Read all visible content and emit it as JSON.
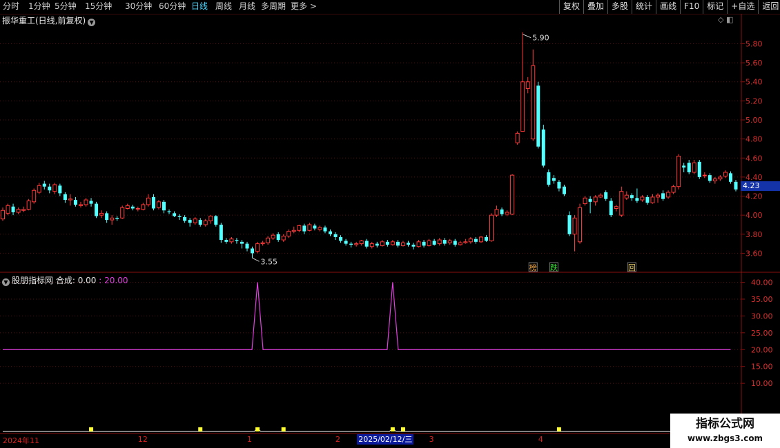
{
  "toolbar": {
    "periods": [
      "分时",
      "1分钟",
      "5分钟",
      "15分钟",
      "30分钟",
      "60分钟",
      "日线",
      "周线",
      "月线",
      "多周期",
      "更多 >"
    ],
    "active_index": 6,
    "right_buttons": [
      "复权",
      "叠加",
      "多股",
      "统计",
      "画线",
      "F10",
      "标记",
      "+自选",
      "返回"
    ]
  },
  "stock": {
    "title": "振华重工(日线,前复权)",
    "last_price": "4.23",
    "high_label": "5.90",
    "low_label": "3.55",
    "signals": [
      {
        "text": "榜",
        "color": "#e8a040",
        "index": 102
      },
      {
        "text": "跌",
        "color": "#33dd33",
        "index": 106
      },
      {
        "text": "回",
        "color": "#d8c060",
        "index": 121
      }
    ],
    "up_color": "#ff3b3b",
    "down_color": "#54ffff"
  },
  "price_axis": {
    "labels": [
      "5.80",
      "5.60",
      "5.40",
      "5.20",
      "5.00",
      "4.80",
      "4.60",
      "4.40",
      "4.20",
      "4.00",
      "3.80",
      "3.60"
    ],
    "max": 5.97,
    "min": 3.48
  },
  "indicator": {
    "name": "股朋指标网",
    "series_label": "合成:",
    "series_value": "0.00",
    "ref_value": "20.00",
    "color": "#e040e0",
    "axis_labels": [
      "40.00",
      "35.00",
      "30.00",
      "25.00",
      "20.00",
      "15.00",
      "10.00"
    ],
    "baseline": 20,
    "spikes": [
      {
        "index": 49,
        "value": 40
      },
      {
        "index": 75,
        "value": 40
      }
    ]
  },
  "markers": {
    "color": "#ffff33",
    "indices": [
      17,
      38,
      49,
      54,
      75,
      77,
      107
    ]
  },
  "date_axis": {
    "labels": [
      {
        "text": "2024年11",
        "index": 0
      },
      {
        "text": "12",
        "index": 26
      },
      {
        "text": "1",
        "index": 47
      },
      {
        "text": "2",
        "index": 64
      },
      {
        "text": "3",
        "index": 82
      },
      {
        "text": "4",
        "index": 103
      }
    ],
    "cursor_label": "2025/02/12/三",
    "cursor_index": 70
  },
  "watermark": {
    "line1": "指标公式网",
    "line2": "www.zbgs3.com"
  },
  "chart_data": {
    "type": "candlestick",
    "title": "振华重工(日线,前复权)",
    "ylim": [
      3.48,
      5.97
    ],
    "candles": [
      [
        3.96,
        4.05,
        4.08,
        3.94
      ],
      [
        4.02,
        4.1,
        4.12,
        4.0
      ],
      [
        4.09,
        4.03,
        4.12,
        4.0
      ],
      [
        4.03,
        4.06,
        4.08,
        4.01
      ],
      [
        4.05,
        4.06,
        4.09,
        4.03
      ],
      [
        4.06,
        4.15,
        4.17,
        4.05
      ],
      [
        4.14,
        4.26,
        4.28,
        4.12
      ],
      [
        4.24,
        4.31,
        4.34,
        4.22
      ],
      [
        4.33,
        4.3,
        4.36,
        4.27
      ],
      [
        4.3,
        4.26,
        4.33,
        4.23
      ],
      [
        4.25,
        4.32,
        4.34,
        4.22
      ],
      [
        4.31,
        4.23,
        4.33,
        4.2
      ],
      [
        4.22,
        4.16,
        4.24,
        4.13
      ],
      [
        4.16,
        4.17,
        4.22,
        4.1
      ],
      [
        4.16,
        4.11,
        4.19,
        4.09
      ],
      [
        4.1,
        4.11,
        4.14,
        4.08
      ],
      [
        4.11,
        4.16,
        4.18,
        4.09
      ],
      [
        4.15,
        4.12,
        4.18,
        4.09
      ],
      [
        4.12,
        3.99,
        4.14,
        3.97
      ],
      [
        4.0,
        4.02,
        4.05,
        3.97
      ],
      [
        4.02,
        3.95,
        4.04,
        3.92
      ],
      [
        3.95,
        3.97,
        4.0,
        3.9
      ],
      [
        3.97,
        3.96,
        3.99,
        3.94
      ],
      [
        3.97,
        4.08,
        4.1,
        3.96
      ],
      [
        4.07,
        4.1,
        4.12,
        4.06
      ],
      [
        4.09,
        4.07,
        4.11,
        4.05
      ],
      [
        4.07,
        4.07,
        4.09,
        4.04
      ],
      [
        4.06,
        4.11,
        4.13,
        4.05
      ],
      [
        4.11,
        4.18,
        4.22,
        4.09
      ],
      [
        4.19,
        4.07,
        4.22,
        4.05
      ],
      [
        4.08,
        4.14,
        4.16,
        4.06
      ],
      [
        4.14,
        4.05,
        4.16,
        4.02
      ],
      [
        4.04,
        4.03,
        4.06,
        4.01
      ],
      [
        4.02,
        3.99,
        4.04,
        3.98
      ],
      [
        3.99,
        3.98,
        4.01,
        3.95
      ],
      [
        3.98,
        3.94,
        4.0,
        3.92
      ],
      [
        3.95,
        3.92,
        3.97,
        3.88
      ],
      [
        3.92,
        3.96,
        3.98,
        3.9
      ],
      [
        3.95,
        3.9,
        3.97,
        3.88
      ],
      [
        3.9,
        3.94,
        3.96,
        3.88
      ],
      [
        3.94,
        3.99,
        4.0,
        3.91
      ],
      [
        3.99,
        3.9,
        4.0,
        3.88
      ],
      [
        3.9,
        3.74,
        3.92,
        3.71
      ],
      [
        3.74,
        3.72,
        3.76,
        3.7
      ],
      [
        3.72,
        3.75,
        3.77,
        3.7
      ],
      [
        3.74,
        3.73,
        3.76,
        3.7
      ],
      [
        3.72,
        3.7,
        3.74,
        3.65
      ],
      [
        3.7,
        3.65,
        3.72,
        3.62
      ],
      [
        3.65,
        3.6,
        3.67,
        3.55
      ],
      [
        3.62,
        3.7,
        3.72,
        3.6
      ],
      [
        3.7,
        3.71,
        3.73,
        3.68
      ],
      [
        3.71,
        3.76,
        3.78,
        3.69
      ],
      [
        3.76,
        3.79,
        3.81,
        3.74
      ],
      [
        3.8,
        3.74,
        3.82,
        3.72
      ],
      [
        3.74,
        3.78,
        3.8,
        3.72
      ],
      [
        3.78,
        3.83,
        3.85,
        3.76
      ],
      [
        3.83,
        3.84,
        3.88,
        3.81
      ],
      [
        3.84,
        3.89,
        3.9,
        3.82
      ],
      [
        3.89,
        3.83,
        3.91,
        3.8
      ],
      [
        3.84,
        3.9,
        3.92,
        3.83
      ],
      [
        3.89,
        3.86,
        3.91,
        3.84
      ],
      [
        3.85,
        3.87,
        3.89,
        3.83
      ],
      [
        3.87,
        3.83,
        3.89,
        3.81
      ],
      [
        3.83,
        3.8,
        3.85,
        3.78
      ],
      [
        3.8,
        3.77,
        3.82,
        3.74
      ],
      [
        3.77,
        3.73,
        3.79,
        3.71
      ],
      [
        3.73,
        3.7,
        3.75,
        3.68
      ],
      [
        3.7,
        3.69,
        3.72,
        3.66
      ],
      [
        3.69,
        3.7,
        3.72,
        3.67
      ],
      [
        3.7,
        3.73,
        3.74,
        3.68
      ],
      [
        3.73,
        3.67,
        3.75,
        3.65
      ],
      [
        3.67,
        3.7,
        3.72,
        3.65
      ],
      [
        3.7,
        3.68,
        3.72,
        3.66
      ],
      [
        3.68,
        3.72,
        3.74,
        3.67
      ],
      [
        3.72,
        3.69,
        3.74,
        3.67
      ],
      [
        3.69,
        3.72,
        3.74,
        3.68
      ],
      [
        3.72,
        3.68,
        3.74,
        3.66
      ],
      [
        3.68,
        3.71,
        3.73,
        3.67
      ],
      [
        3.71,
        3.69,
        3.73,
        3.67
      ],
      [
        3.69,
        3.67,
        3.71,
        3.64
      ],
      [
        3.67,
        3.72,
        3.74,
        3.66
      ],
      [
        3.72,
        3.68,
        3.74,
        3.66
      ],
      [
        3.68,
        3.73,
        3.75,
        3.67
      ],
      [
        3.73,
        3.69,
        3.75,
        3.68
      ],
      [
        3.7,
        3.74,
        3.76,
        3.68
      ],
      [
        3.74,
        3.7,
        3.76,
        3.68
      ],
      [
        3.71,
        3.73,
        3.75,
        3.69
      ],
      [
        3.73,
        3.69,
        3.75,
        3.67
      ],
      [
        3.69,
        3.71,
        3.73,
        3.68
      ],
      [
        3.71,
        3.72,
        3.75,
        3.7
      ],
      [
        3.72,
        3.75,
        3.77,
        3.7
      ],
      [
        3.75,
        3.72,
        3.77,
        3.7
      ],
      [
        3.72,
        3.77,
        3.78,
        3.71
      ],
      [
        3.77,
        3.73,
        3.79,
        3.72
      ],
      [
        3.73,
        4.0,
        4.02,
        3.72
      ],
      [
        4.0,
        4.06,
        4.1,
        3.98
      ],
      [
        4.06,
        4.01,
        4.08,
        3.99
      ],
      [
        4.01,
        4.03,
        4.05,
        3.99
      ],
      [
        4.01,
        4.42,
        4.43,
        4.0
      ],
      [
        4.76,
        4.86,
        4.88,
        4.74
      ],
      [
        4.88,
        5.4,
        5.92,
        5.3
      ],
      [
        5.33,
        5.4,
        5.45,
        5.28
      ],
      [
        4.8,
        5.57,
        5.74,
        4.78
      ],
      [
        5.36,
        4.72,
        5.4,
        4.7
      ],
      [
        4.9,
        4.52,
        4.95,
        4.5
      ],
      [
        4.45,
        4.32,
        4.48,
        4.3
      ],
      [
        4.39,
        4.36,
        4.42,
        4.33
      ],
      [
        4.35,
        4.28,
        4.37,
        4.25
      ],
      [
        4.3,
        4.22,
        4.32,
        4.2
      ],
      [
        4.0,
        3.8,
        4.04,
        3.78
      ],
      [
        3.8,
        3.97,
        4.0,
        3.62
      ],
      [
        3.72,
        4.08,
        4.12,
        3.7
      ],
      [
        4.12,
        4.18,
        4.2,
        4.1
      ],
      [
        4.17,
        4.14,
        4.2,
        4.02
      ],
      [
        4.14,
        4.19,
        4.21,
        4.1
      ],
      [
        4.19,
        4.21,
        4.23,
        4.18
      ],
      [
        4.24,
        4.17,
        4.26,
        4.15
      ],
      [
        4.15,
        4.0,
        4.18,
        3.98
      ],
      [
        4.07,
        4.09,
        4.11,
        4.04
      ],
      [
        4.0,
        4.25,
        4.3,
        3.98
      ],
      [
        4.18,
        4.21,
        4.25,
        4.16
      ],
      [
        4.21,
        4.18,
        4.23,
        4.15
      ],
      [
        4.18,
        4.15,
        4.28,
        4.13
      ],
      [
        4.16,
        4.19,
        4.21,
        4.14
      ],
      [
        4.19,
        4.13,
        4.21,
        4.11
      ],
      [
        4.13,
        4.19,
        4.22,
        4.12
      ],
      [
        4.19,
        4.21,
        4.23,
        4.13
      ],
      [
        4.23,
        4.17,
        4.26,
        4.15
      ],
      [
        4.19,
        4.24,
        4.26,
        4.17
      ],
      [
        4.24,
        4.3,
        4.32,
        4.22
      ],
      [
        4.3,
        4.62,
        4.64,
        4.27
      ],
      [
        4.52,
        4.5,
        4.55,
        4.45
      ],
      [
        4.55,
        4.45,
        4.58,
        4.43
      ],
      [
        4.45,
        4.55,
        4.58,
        4.43
      ],
      [
        4.56,
        4.4,
        4.58,
        4.38
      ],
      [
        4.42,
        4.42,
        4.45,
        4.39
      ],
      [
        4.42,
        4.36,
        4.44,
        4.34
      ],
      [
        4.36,
        4.38,
        4.4,
        4.33
      ],
      [
        4.38,
        4.4,
        4.42,
        4.36
      ],
      [
        4.41,
        4.45,
        4.47,
        4.39
      ],
      [
        4.44,
        4.35,
        4.46,
        4.33
      ],
      [
        4.35,
        4.27,
        4.37,
        4.25
      ]
    ]
  }
}
